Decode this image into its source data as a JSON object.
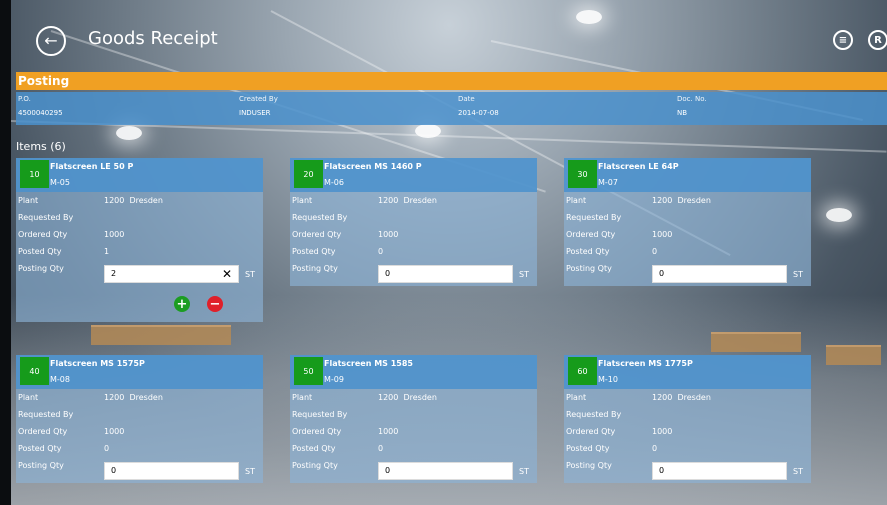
{
  "app": {
    "title": "Goods Receipt"
  },
  "section": {
    "posting_label": "Posting",
    "items_label": "Items (6)"
  },
  "header": {
    "po_label": "P.O.",
    "po_value": "4500040295",
    "created_label": "Created By",
    "created_value": "INDUSER",
    "date_label": "Date",
    "date_value": "2014-07-08",
    "doc_label": "Doc. No.",
    "doc_value": "NB"
  },
  "labels": {
    "plant": "Plant",
    "requested_by": "Requested By",
    "ordered_qty": "Ordered Qty",
    "posted_qty": "Posted Qty",
    "posting_qty": "Posting Qty",
    "unit": "ST"
  },
  "items": [
    {
      "num": "10",
      "title": "Flatscreen LE 50 P",
      "mat": "M-05",
      "plant": "1200",
      "city": "Dresden",
      "requested": "",
      "ordered": "1000",
      "posted": "1",
      "posting": "2"
    },
    {
      "num": "20",
      "title": "Flatscreen MS 1460 P",
      "mat": "M-06",
      "plant": "1200",
      "city": "Dresden",
      "requested": "",
      "ordered": "1000",
      "posted": "0",
      "posting": "0"
    },
    {
      "num": "30",
      "title": "Flatscreen LE 64P",
      "mat": "M-07",
      "plant": "1200",
      "city": "Dresden",
      "requested": "",
      "ordered": "1000",
      "posted": "0",
      "posting": "0"
    },
    {
      "num": "40",
      "title": "Flatscreen MS 1575P",
      "mat": "M-08",
      "plant": "1200",
      "city": "Dresden",
      "requested": "",
      "ordered": "1000",
      "posted": "0",
      "posting": "0"
    },
    {
      "num": "50",
      "title": "Flatscreen MS 1585",
      "mat": "M-09",
      "plant": "1200",
      "city": "Dresden",
      "requested": "",
      "ordered": "1000",
      "posted": "0",
      "posting": "0"
    },
    {
      "num": "60",
      "title": "Flatscreen MS 1775P",
      "mat": "M-10",
      "plant": "1200",
      "city": "Dresden",
      "requested": "",
      "ordered": "1000",
      "posted": "0",
      "posting": "0"
    }
  ],
  "icons": {
    "back": "back-arrow-icon",
    "list": "list-icon",
    "r": "r-circle-icon",
    "clear": "clear-x-icon",
    "plus": "plus-icon",
    "minus": "minus-icon"
  },
  "colors": {
    "posting_bar": "#f0a023",
    "header_band": "#4a90cd",
    "item_number": "#169b1b",
    "plus": "#1c9d22",
    "minus": "#e0202a"
  }
}
